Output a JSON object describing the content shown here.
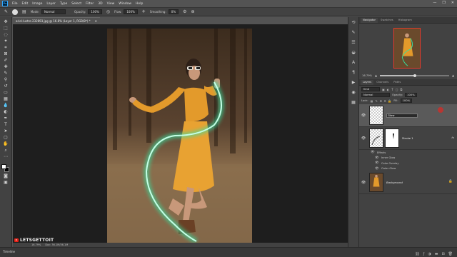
{
  "menubar": {
    "app_badge": "Ps",
    "items": [
      "File",
      "Edit",
      "Image",
      "Layer",
      "Type",
      "Select",
      "Filter",
      "3D",
      "View",
      "Window",
      "Help"
    ],
    "window_controls": [
      "—",
      "❐",
      "✕"
    ]
  },
  "options": {
    "mode_label": "Mode:",
    "mode_value": "Normal",
    "opacity_label": "Opacity:",
    "opacity_value": "100%",
    "flow_label": "Flow:",
    "flow_value": "100%",
    "smoothing_label": "Smoothing:",
    "smoothing_value": "0%"
  },
  "document": {
    "tab_title": "ariel-lustre-232893.jpg @ 16.8% (Layer 1, RGB/8*) *",
    "close": "✕",
    "status_zoom": "16.79%",
    "status_doc": "Doc: 36.1M/36.1M"
  },
  "watermark": {
    "text": "LETSGETTOIT"
  },
  "timeline": {
    "label": "Timeline"
  },
  "navigator": {
    "tabs": [
      "Navigator",
      "Swatches",
      "Histogram"
    ],
    "zoom_value": "16.79%",
    "zoom_level": 0.5
  },
  "layers": {
    "tabs": [
      "Layers",
      "Channels",
      "Paths"
    ],
    "filter_kind": "Kind",
    "blend_mode": "Normal",
    "opacity_label": "Opacity:",
    "opacity_value": "100%",
    "lock_label": "Lock:",
    "fill_label": "Fill:",
    "fill_value": "100%",
    "items": [
      {
        "name": "Glow",
        "selected": true
      },
      {
        "name": "Stroke 1",
        "fx": "fx"
      },
      {
        "name": "Background"
      }
    ],
    "effects_header": "Effects",
    "effects": [
      "Inner Glow",
      "Color Overlay",
      "Outer Glow"
    ]
  },
  "colors": {
    "glow": "#35e0a0",
    "accent_red": "#c9302c",
    "foreground": "#ffffff",
    "background": "#000000"
  }
}
